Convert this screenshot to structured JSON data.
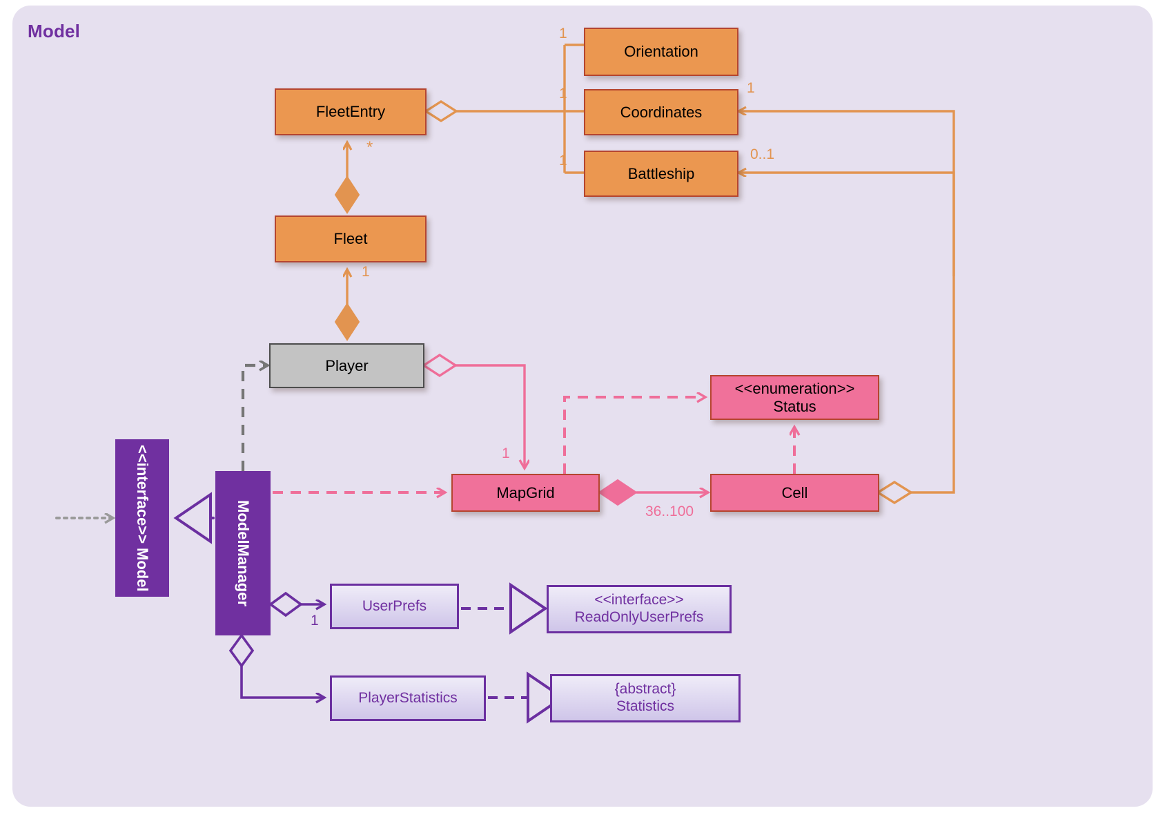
{
  "panel": {
    "title": "Model",
    "background": "#e6e0ef",
    "title_color": "#7030a0"
  },
  "colors": {
    "orange_fill": "#eb9750",
    "orange_border": "#b5452f",
    "orange_line": "#e29450",
    "pink_fill": "#f0719a",
    "pink_line": "#ef6e99",
    "purple_solid": "#7030a0",
    "purple_line": "#6b2fa0",
    "gray_fill": "#c3c3c3",
    "gray_line": "#808080"
  },
  "classes": {
    "fleet_entry": {
      "name": "FleetEntry"
    },
    "fleet": {
      "name": "Fleet"
    },
    "orientation": {
      "name": "Orientation"
    },
    "coordinates": {
      "name": "Coordinates"
    },
    "battleship": {
      "name": "Battleship"
    },
    "player": {
      "name": "Player"
    },
    "model": {
      "stereotype": "<<interface>>",
      "name": "Model"
    },
    "model_manager": {
      "name": "ModelManager"
    },
    "map_grid": {
      "name": "MapGrid"
    },
    "status": {
      "stereotype": "<<enumeration>>",
      "name": "Status"
    },
    "cell": {
      "name": "Cell"
    },
    "user_prefs": {
      "name": "UserPrefs"
    },
    "read_only_user_prefs": {
      "stereotype": "<<interface>>",
      "name": "ReadOnlyUserPrefs"
    },
    "player_statistics": {
      "name": "PlayerStatistics"
    },
    "statistics": {
      "stereotype": "{abstract}",
      "name": "Statistics"
    }
  },
  "multiplicities": {
    "orientation_one": "1",
    "coordinates_one": "1",
    "battleship_one": "1",
    "cell_to_coordinates": "1",
    "cell_to_battleship": "0..1",
    "fleet_entry_star": "*",
    "fleet_one": "1",
    "map_grid_one": "1",
    "cells_range": "36..100",
    "user_prefs_one": "1"
  }
}
